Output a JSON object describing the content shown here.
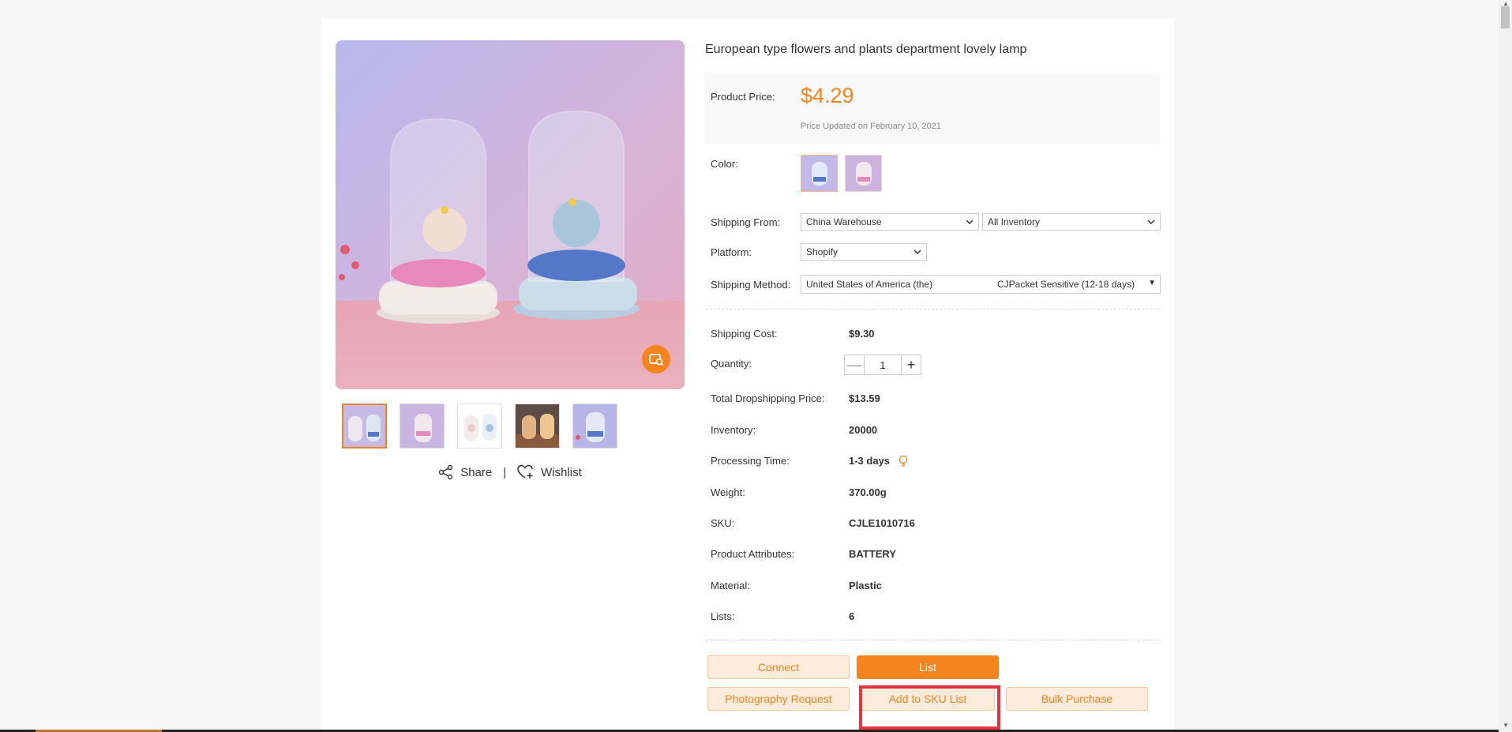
{
  "product": {
    "title": "European type flowers and plants department lovely lamp",
    "price_label": "Product Price:",
    "price": "$4.29",
    "price_note": "Price Updated on February 10, 2021"
  },
  "gallery": {
    "share_label": "Share",
    "separator": "|",
    "wishlist_label": "Wishlist",
    "thumbnail_count": 5,
    "active_thumbnail": 1
  },
  "options": {
    "color_label": "Color:",
    "shipping_from_label": "Shipping From:",
    "warehouse": "China Warehouse",
    "inventory_filter": "All Inventory",
    "platform_label": "Platform:",
    "platform": "Shopify",
    "shipping_method_label": "Shipping Method:",
    "destination": "United States of America (the)",
    "method": "CJPacket Sensitive (12-18 days)"
  },
  "details": {
    "shipping_cost_label": "Shipping Cost:",
    "shipping_cost": "$9.30",
    "quantity_label": "Quantity:",
    "quantity": "1",
    "minus": "—",
    "plus": "+",
    "total_label": "Total Dropshipping Price:",
    "total": "$13.59",
    "inventory_label": "Inventory:",
    "inventory": "20000",
    "processing_label": "Processing Time:",
    "processing": "1-3 days",
    "weight_label": "Weight:",
    "weight": "370.00g",
    "sku_label": "SKU:",
    "sku": "CJLE1010716",
    "attributes_label": "Product Attributes:",
    "attributes": "BATTERY",
    "material_label": "Material:",
    "material": "Plastic",
    "lists_label": "Lists:",
    "lists": "6"
  },
  "actions": {
    "connect": "Connect",
    "list": "List",
    "photography": "Photography Request",
    "add_sku": "Add to SKU List",
    "bulk": "Bulk Purchase"
  },
  "colors": {
    "accent": "#f5841f",
    "highlight": "#e5343e"
  }
}
